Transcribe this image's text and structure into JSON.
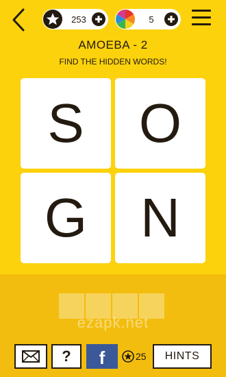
{
  "header": {
    "stars_count": "253",
    "colors_count": "5"
  },
  "level": {
    "title": "AMOEBA - 2",
    "instruction": "FIND THE HIDDEN WORDS!"
  },
  "tiles": [
    "S",
    "O",
    "G",
    "N"
  ],
  "answer_slots": 4,
  "watermark": "ezapk.net",
  "bottom_bar": {
    "help_label": "?",
    "facebook_label": "f",
    "hint_cost": "25",
    "hints_label": "HINTS"
  },
  "colors": {
    "background": "#fcd20c",
    "bottom_background": "#f2bd0f",
    "dark": "#231a10",
    "facebook": "#3b5998"
  }
}
